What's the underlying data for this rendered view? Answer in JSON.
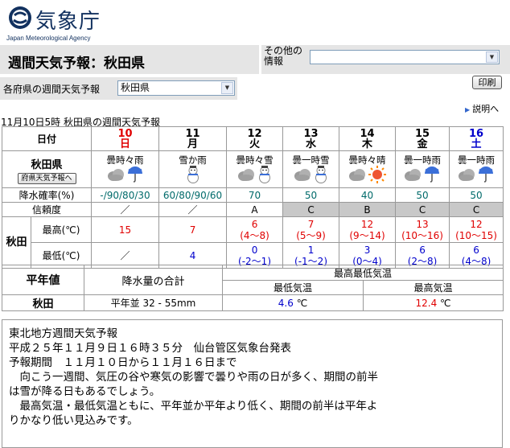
{
  "agency": {
    "name": "気象庁",
    "name_en": "Japan Meteorological Agency"
  },
  "header": {
    "title": "週間天気予報：秋田県"
  },
  "other_info": {
    "label": "その他の情報",
    "value": ""
  },
  "pref_select": {
    "label": "各府県の週間天気予報",
    "value": "秋田県"
  },
  "print_label": "印刷",
  "explain_label": "説明へ",
  "issued": "11月10日5時  秋田県の週間天気予報",
  "table": {
    "col_date_label": "日付",
    "pref_name": "秋田県",
    "pref_button": "府県天気予報へ",
    "precip_label": "降水確率(%)",
    "reliability_label": "信頼度",
    "region_label": "秋田",
    "max_label": "最高(℃)",
    "min_label": "最低(℃)",
    "days": [
      {
        "date": "10",
        "dow": "日",
        "color": "#e00000",
        "weather": "曇時々雨",
        "icons": [
          "cloud",
          "umbrella"
        ],
        "precip": "-/90/80/30",
        "reliability": "／",
        "max": "15",
        "max_range": "",
        "min": "／",
        "min_range": ""
      },
      {
        "date": "11",
        "dow": "月",
        "color": "#000000",
        "weather": "雪か雨",
        "icons": [
          "snowman"
        ],
        "precip": "60/80/90/60",
        "reliability": "／",
        "max": "7",
        "max_range": "",
        "min": "4",
        "min_range": ""
      },
      {
        "date": "12",
        "dow": "火",
        "color": "#000000",
        "weather": "曇時々雪",
        "icons": [
          "cloud",
          "snowman"
        ],
        "precip": "70",
        "reliability": "A",
        "max": "6",
        "max_range": "(4〜8)",
        "min": "0",
        "min_range": "(-2〜1)"
      },
      {
        "date": "13",
        "dow": "水",
        "color": "#000000",
        "weather": "曇一時雪",
        "icons": [
          "cloud",
          "snowman"
        ],
        "precip": "50",
        "reliability": "C",
        "max": "7",
        "max_range": "(5〜9)",
        "min": "1",
        "min_range": "(-1〜2)"
      },
      {
        "date": "14",
        "dow": "木",
        "color": "#000000",
        "weather": "曇時々晴",
        "icons": [
          "cloud",
          "sun"
        ],
        "precip": "40",
        "reliability": "B",
        "max": "12",
        "max_range": "(9〜14)",
        "min": "3",
        "min_range": "(0〜4)"
      },
      {
        "date": "15",
        "dow": "金",
        "color": "#000000",
        "weather": "曇一時雨",
        "icons": [
          "cloud",
          "umbrella"
        ],
        "precip": "50",
        "reliability": "C",
        "max": "13",
        "max_range": "(10〜16)",
        "min": "6",
        "min_range": "(2〜8)"
      },
      {
        "date": "16",
        "dow": "土",
        "color": "#0000cc",
        "weather": "曇一時雨",
        "icons": [
          "cloud",
          "umbrella"
        ],
        "precip": "50",
        "reliability": "C",
        "max": "12",
        "max_range": "(10〜15)",
        "min": "6",
        "min_range": "(4〜8)"
      }
    ]
  },
  "normals": {
    "title": "平年値",
    "precip_header": "降水量の合計",
    "temp_header": "最高最低気温",
    "min_header": "最低気温",
    "max_header": "最高気温",
    "region": "秋田",
    "precip_prefix": "平年並",
    "precip_value": "32 - 55mm",
    "min_value": "4.6",
    "max_value": "12.4",
    "unit": "℃"
  },
  "forecast": {
    "lines": [
      "東北地方週間天気予報",
      "平成２５年１１月９日１６時３５分　仙台管区気象台発表",
      "",
      "予報期間　１１月１０日から１１月１６日まで",
      "　向こう一週間、気圧の谷や寒気の影響で曇りや雨の日が多く、期間の前半",
      "は雪が降る日もあるでしょう。",
      "　最高気温・最低気温ともに、平年並か平年より低く、期間の前半は平年よ",
      "りかなり低い見込みです。"
    ]
  }
}
